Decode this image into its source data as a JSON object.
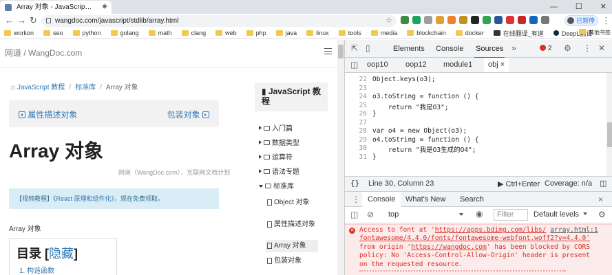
{
  "browser": {
    "tab_title": "Array 对象 - JavaScript 教程 - 网",
    "tab_close": "×",
    "new_tab": "+",
    "win_min": "—",
    "win_max": "☐",
    "win_close": "✕",
    "back": "←",
    "forward": "→",
    "reload": "↻",
    "url": "wangdoc.com/javascript/stdlib/array.html",
    "star": "☆",
    "profile_label": "已暂停",
    "menu": "⋮",
    "bookmarks": [
      {
        "label": "workon"
      },
      {
        "label": "seo"
      },
      {
        "label": "python"
      },
      {
        "label": "golang"
      },
      {
        "label": "math"
      },
      {
        "label": "clang"
      },
      {
        "label": "web"
      },
      {
        "label": "php"
      },
      {
        "label": "java"
      },
      {
        "label": "linux"
      },
      {
        "label": "tools"
      },
      {
        "label": "media"
      },
      {
        "label": "blockchain"
      },
      {
        "label": "docker"
      },
      {
        "label": "在线翻译_有道"
      },
      {
        "label": "DeepL翻译"
      }
    ],
    "bookmarks_more": "»",
    "other_bookmarks": "其他书签"
  },
  "page": {
    "site_title": "网道 / WangDoc.com",
    "breadcrumb": {
      "home": "JavaScript 教程",
      "lib": "标准库",
      "current": "Array 对象",
      "sep": "/"
    },
    "prev_link": "属性描述对象",
    "next_link": "包装对象",
    "title": "Array 对象",
    "copyright": "网道（WangDoc.com），互联网文档计划",
    "promo_prefix": "【视频教程】",
    "promo_link": "《React 原理和组件化》",
    "promo_suffix": "，现在免费领取。",
    "section_label": "Array 对象",
    "toc_title": "目录 [",
    "toc_hide": "隐藏",
    "toc_close": "]",
    "toc_item": "1. 构造函数",
    "sidebar_title": "JavaScript 教程",
    "sidebar_cats": [
      "入门篇",
      "数据类型",
      "运算符",
      "语法专题",
      "标准库"
    ],
    "sidebar_subs": [
      "Object 对象",
      "属性描述对象",
      "Array 对象",
      "包装对象"
    ]
  },
  "devtools": {
    "tabs": [
      "Elements",
      "Console",
      "Sources"
    ],
    "active_tab": "Sources",
    "more_tabs": "»",
    "error_count": "2",
    "file_tabs": [
      "oop10",
      "oop12",
      "module1",
      "obj"
    ],
    "file_close": "×",
    "code_lines": [
      {
        "n": "22",
        "text": "Object.keys(o3);"
      },
      {
        "n": "23",
        "text": ""
      },
      {
        "n": "24",
        "text": "o3.toString = function () {"
      },
      {
        "n": "25",
        "text": "    return \"我是O3\";"
      },
      {
        "n": "26",
        "text": "}"
      },
      {
        "n": "27",
        "text": ""
      },
      {
        "n": "28",
        "text": "var o4 = new Object(o3);"
      },
      {
        "n": "29",
        "text": "o4.toString = function () {"
      },
      {
        "n": "30",
        "text": "    return \"我是O3生成的O4\";"
      },
      {
        "n": "31",
        "text": "}"
      }
    ],
    "status": {
      "braces": "{}",
      "position": "Line 30, Column 23",
      "run": "Ctrl+Enter",
      "coverage": "Coverage: n/a"
    },
    "drawer_tabs": [
      "Console",
      "What's New",
      "Search"
    ],
    "drawer_close": "×",
    "context": "top",
    "filter_placeholder": "Filter",
    "levels": "Default levels",
    "error_message": {
      "l1_pre": "Access to font at '",
      "l1_url": "https://apps.bdimg.com/libs/",
      "l1_sp": " ",
      "l1_file": "array.html:1",
      "l2": "fontawesome/4.4.0/fonts/fontawesome-webfont.woff2?v=4.4.0'",
      "l3_pre": "from origin '",
      "l3_url": "https://wangdoc.com",
      "l3_post": "' has been blocked by CORS",
      "l4": "policy: No 'Access-Control-Allow-Origin' header is present",
      "l5": "on the requested resource."
    }
  },
  "colors": {
    "link": "#337ab7",
    "accent": "#1a73e8",
    "error": "#d93025"
  }
}
